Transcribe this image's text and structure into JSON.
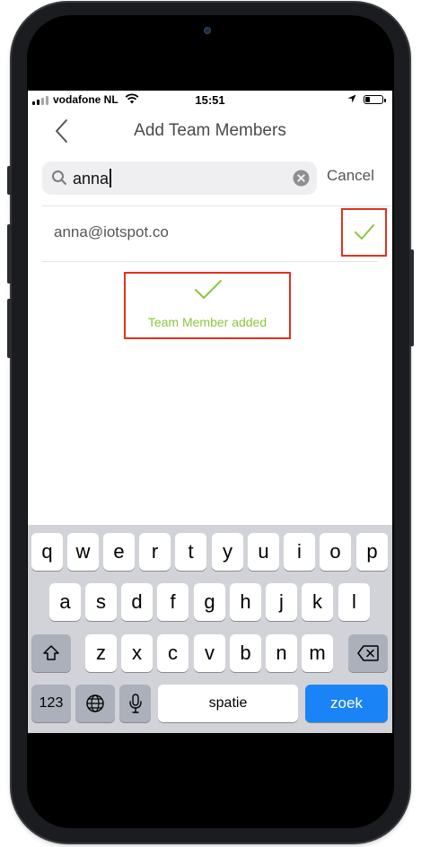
{
  "status_bar": {
    "carrier": "vodafone NL",
    "time": "15:51"
  },
  "nav": {
    "title": "Add Team Members",
    "back_icon": "chevron-left-icon"
  },
  "search": {
    "query": "anna",
    "cancel_label": "Cancel"
  },
  "results": [
    {
      "email": "anna@iotspot.co",
      "added": true
    }
  ],
  "toast": {
    "message": "Team Member added"
  },
  "keyboard": {
    "row1": [
      "q",
      "w",
      "e",
      "r",
      "t",
      "y",
      "u",
      "i",
      "o",
      "p"
    ],
    "row2": [
      "a",
      "s",
      "d",
      "f",
      "g",
      "h",
      "j",
      "k",
      "l"
    ],
    "row3": [
      "z",
      "x",
      "c",
      "v",
      "b",
      "n",
      "m"
    ],
    "numbers_label": "123",
    "space_label": "spatie",
    "go_label": "zoek"
  },
  "colors": {
    "accent_green": "#8cc63f",
    "highlight_red": "#e0331f",
    "keyboard_blue": "#1a84f6"
  }
}
